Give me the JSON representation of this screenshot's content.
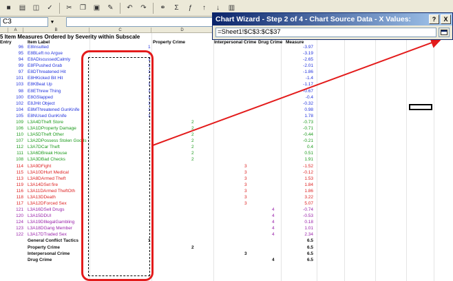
{
  "namebox": {
    "value": "C3"
  },
  "wizard": {
    "title": "Chart Wizard - Step 2 of 4 - Chart Source Data - X Values:",
    "help_label": "?",
    "close_label": "X",
    "reference": "=Sheet1!$C$3:$C$37"
  },
  "sheet": {
    "col_headers": [
      "A",
      "B",
      "C",
      "D"
    ],
    "title": "5 Item Measures Ordered by Severity within Subscale",
    "headers": {
      "entry": "Entry",
      "label": "Item Label",
      "c": "",
      "property": "Property Crime",
      "interpersonal": "Interpersonal Crime",
      "drug": "Drug Crime",
      "measure": "Measure"
    },
    "rows": [
      {
        "entry": "96",
        "label": "E8Insulted",
        "c": "1",
        "d": "",
        "e": "",
        "f": "",
        "m": "-3.97",
        "color": "blue"
      },
      {
        "entry": "95",
        "label": "E8BLeft no Argue",
        "c": "1",
        "d": "",
        "e": "",
        "f": "",
        "m": "-3.19",
        "color": "blue"
      },
      {
        "entry": "94",
        "label": "E8ADiscussedCalmly",
        "c": "1",
        "d": "",
        "e": "",
        "f": "",
        "m": "-2.65",
        "color": "blue"
      },
      {
        "entry": "99",
        "label": "E8FPushed Grab",
        "c": "1",
        "d": "",
        "e": "",
        "f": "",
        "m": "-2.01",
        "color": "blue"
      },
      {
        "entry": "97",
        "label": "E8DThreatened Hit",
        "c": "1",
        "d": "",
        "e": "",
        "f": "",
        "m": "-1.86",
        "color": "blue"
      },
      {
        "entry": "101",
        "label": "E8HKicked Bit Hit",
        "c": "1",
        "d": "",
        "e": "",
        "f": "",
        "m": "-1.4",
        "color": "blue"
      },
      {
        "entry": "103",
        "label": "E8KBeat Up",
        "c": "1",
        "d": "",
        "e": "",
        "f": "",
        "m": "-1.17",
        "color": "blue"
      },
      {
        "entry": "98",
        "label": "E8EThrew Thing",
        "c": "1",
        "d": "",
        "e": "",
        "f": "",
        "m": "-0.67",
        "color": "blue"
      },
      {
        "entry": "100",
        "label": "E8GSlapped",
        "c": "1",
        "d": "",
        "e": "",
        "f": "",
        "m": "-0.4",
        "color": "blue"
      },
      {
        "entry": "102",
        "label": "E8JHit Object",
        "c": "1",
        "d": "",
        "e": "",
        "f": "",
        "m": "-0.32",
        "color": "blue"
      },
      {
        "entry": "104",
        "label": "E8MThreatened GunKnife",
        "c": "1",
        "d": "",
        "e": "",
        "f": "",
        "m": "0.98",
        "color": "blue"
      },
      {
        "entry": "105",
        "label": "E8NUsed GunKnife",
        "c": "1",
        "d": "",
        "e": "",
        "f": "",
        "m": "1.78",
        "color": "blue"
      },
      {
        "entry": "109",
        "label": "L3A4DTheft Store",
        "c": "",
        "d": "2",
        "e": "",
        "f": "",
        "m": "-0.73",
        "color": "green"
      },
      {
        "entry": "106",
        "label": "L3A1DProperty Damage",
        "c": "",
        "d": "2",
        "e": "",
        "f": "",
        "m": "-0.71",
        "color": "green"
      },
      {
        "entry": "110",
        "label": "L3A5DTheft Other",
        "c": "",
        "d": "2",
        "e": "",
        "f": "",
        "m": "-0.44",
        "color": "green"
      },
      {
        "entry": "107",
        "label": "L3A2DPossess Stolen Goods",
        "c": "",
        "d": "2",
        "e": "",
        "f": "",
        "m": "-0.21",
        "color": "green"
      },
      {
        "entry": "112",
        "label": "L3A7DCar Theft",
        "c": "",
        "d": "2",
        "e": "",
        "f": "",
        "m": "0.4",
        "color": "green"
      },
      {
        "entry": "111",
        "label": "L3A6DBreak House",
        "c": "",
        "d": "2",
        "e": "",
        "f": "",
        "m": "0.51",
        "color": "green"
      },
      {
        "entry": "108",
        "label": "L3A3DBad Checks",
        "c": "",
        "d": "2",
        "e": "",
        "f": "",
        "m": "1.91",
        "color": "green"
      },
      {
        "entry": "114",
        "label": "L3A9DFight",
        "c": "",
        "d": "",
        "e": "3",
        "f": "",
        "m": "-1.52",
        "color": "red"
      },
      {
        "entry": "115",
        "label": "L3A10DHurt Medical",
        "c": "",
        "d": "",
        "e": "3",
        "f": "",
        "m": "-0.12",
        "color": "red"
      },
      {
        "entry": "113",
        "label": "L3A8DArmed Theft",
        "c": "",
        "d": "",
        "e": "3",
        "f": "",
        "m": "1.53",
        "color": "red"
      },
      {
        "entry": "119",
        "label": "L3A14DSet fire",
        "c": "",
        "d": "",
        "e": "3",
        "f": "",
        "m": "1.84",
        "color": "red"
      },
      {
        "entry": "116",
        "label": "L3A11DArmed TheftOth",
        "c": "",
        "d": "",
        "e": "3",
        "f": "",
        "m": "1.86",
        "color": "red"
      },
      {
        "entry": "118",
        "label": "L3A13DDeath",
        "c": "",
        "d": "",
        "e": "3",
        "f": "",
        "m": "3.22",
        "color": "red"
      },
      {
        "entry": "117",
        "label": "L3A12DForced Sex",
        "c": "",
        "d": "",
        "e": "3",
        "f": "",
        "m": "5.07",
        "color": "red"
      },
      {
        "entry": "121",
        "label": "L3A16DSell Drugs",
        "c": "",
        "d": "",
        "e": "",
        "f": "4",
        "m": "-0.74",
        "color": "purple"
      },
      {
        "entry": "120",
        "label": "L3A15DDUI",
        "c": "",
        "d": "",
        "e": "",
        "f": "4",
        "m": "-0.53",
        "color": "purple"
      },
      {
        "entry": "124",
        "label": "L3A19DIllegalGambling",
        "c": "",
        "d": "",
        "e": "",
        "f": "4",
        "m": "0.18",
        "color": "purple"
      },
      {
        "entry": "123",
        "label": "L3A18DGang Member",
        "c": "",
        "d": "",
        "e": "",
        "f": "4",
        "m": "1.01",
        "color": "purple"
      },
      {
        "entry": "122",
        "label": "L3A17DTraded Sex",
        "c": "",
        "d": "",
        "e": "",
        "f": "4",
        "m": "2.34",
        "color": "purple"
      },
      {
        "entry": "",
        "label": "General Conflict Tactics",
        "c": "1",
        "d": "",
        "e": "",
        "f": "",
        "m": "6.5",
        "color": "black"
      },
      {
        "entry": "",
        "label": "Property Crime",
        "c": "",
        "d": "2",
        "e": "",
        "f": "",
        "m": "6.5",
        "color": "black"
      },
      {
        "entry": "",
        "label": "Interpersonal Crime",
        "c": "",
        "d": "",
        "e": "3",
        "f": "",
        "m": "6.5",
        "color": "black"
      },
      {
        "entry": "",
        "label": "Drug Crime",
        "c": "",
        "d": "",
        "e": "",
        "f": "4",
        "m": "6.5",
        "color": "black"
      }
    ]
  },
  "colors": {
    "highlight": "#e31b1b",
    "title_bar": "#0a246a"
  }
}
